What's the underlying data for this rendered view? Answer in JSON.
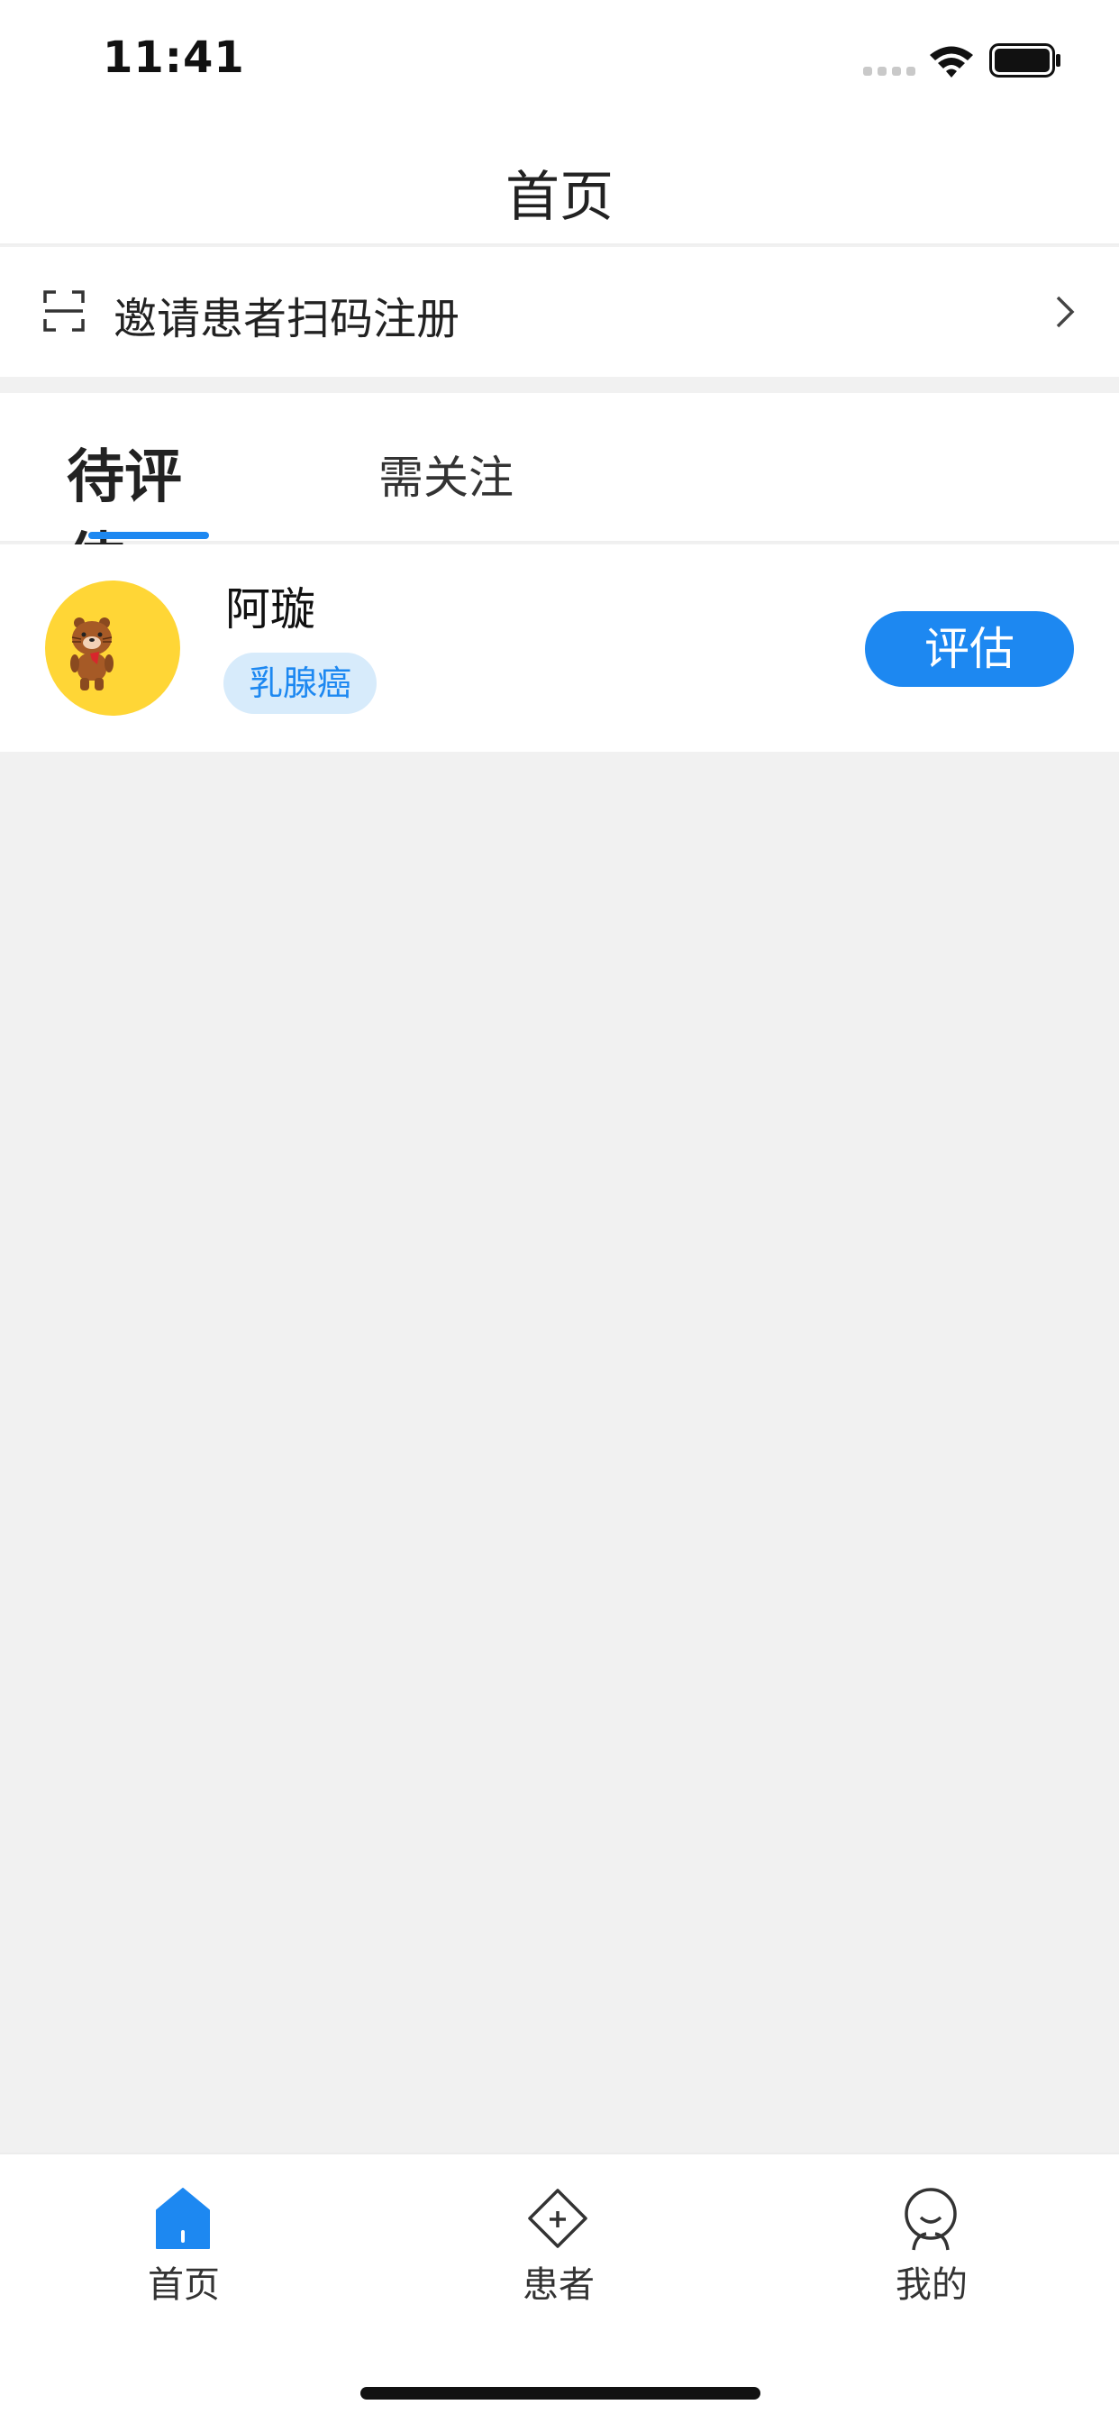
{
  "status_bar": {
    "time": "11:41"
  },
  "nav": {
    "title": "首页"
  },
  "invite": {
    "label": "邀请患者扫码注册"
  },
  "tabs": [
    {
      "label": "待评估",
      "active": true
    },
    {
      "label": "需关注",
      "active": false
    }
  ],
  "patients": [
    {
      "name": "阿璇",
      "tag": "乳腺癌",
      "action": "评估"
    }
  ],
  "tab_bar": [
    {
      "label": "首页",
      "icon": "home-icon",
      "active": true
    },
    {
      "label": "患者",
      "icon": "patient-diamond-icon",
      "active": false
    },
    {
      "label": "我的",
      "icon": "profile-icon",
      "active": false
    }
  ],
  "colors": {
    "accent": "#1d88f1",
    "tag_bg": "#d7ebfb",
    "avatar_bg": "#ffd636",
    "page_bg": "#f1f1f1"
  }
}
